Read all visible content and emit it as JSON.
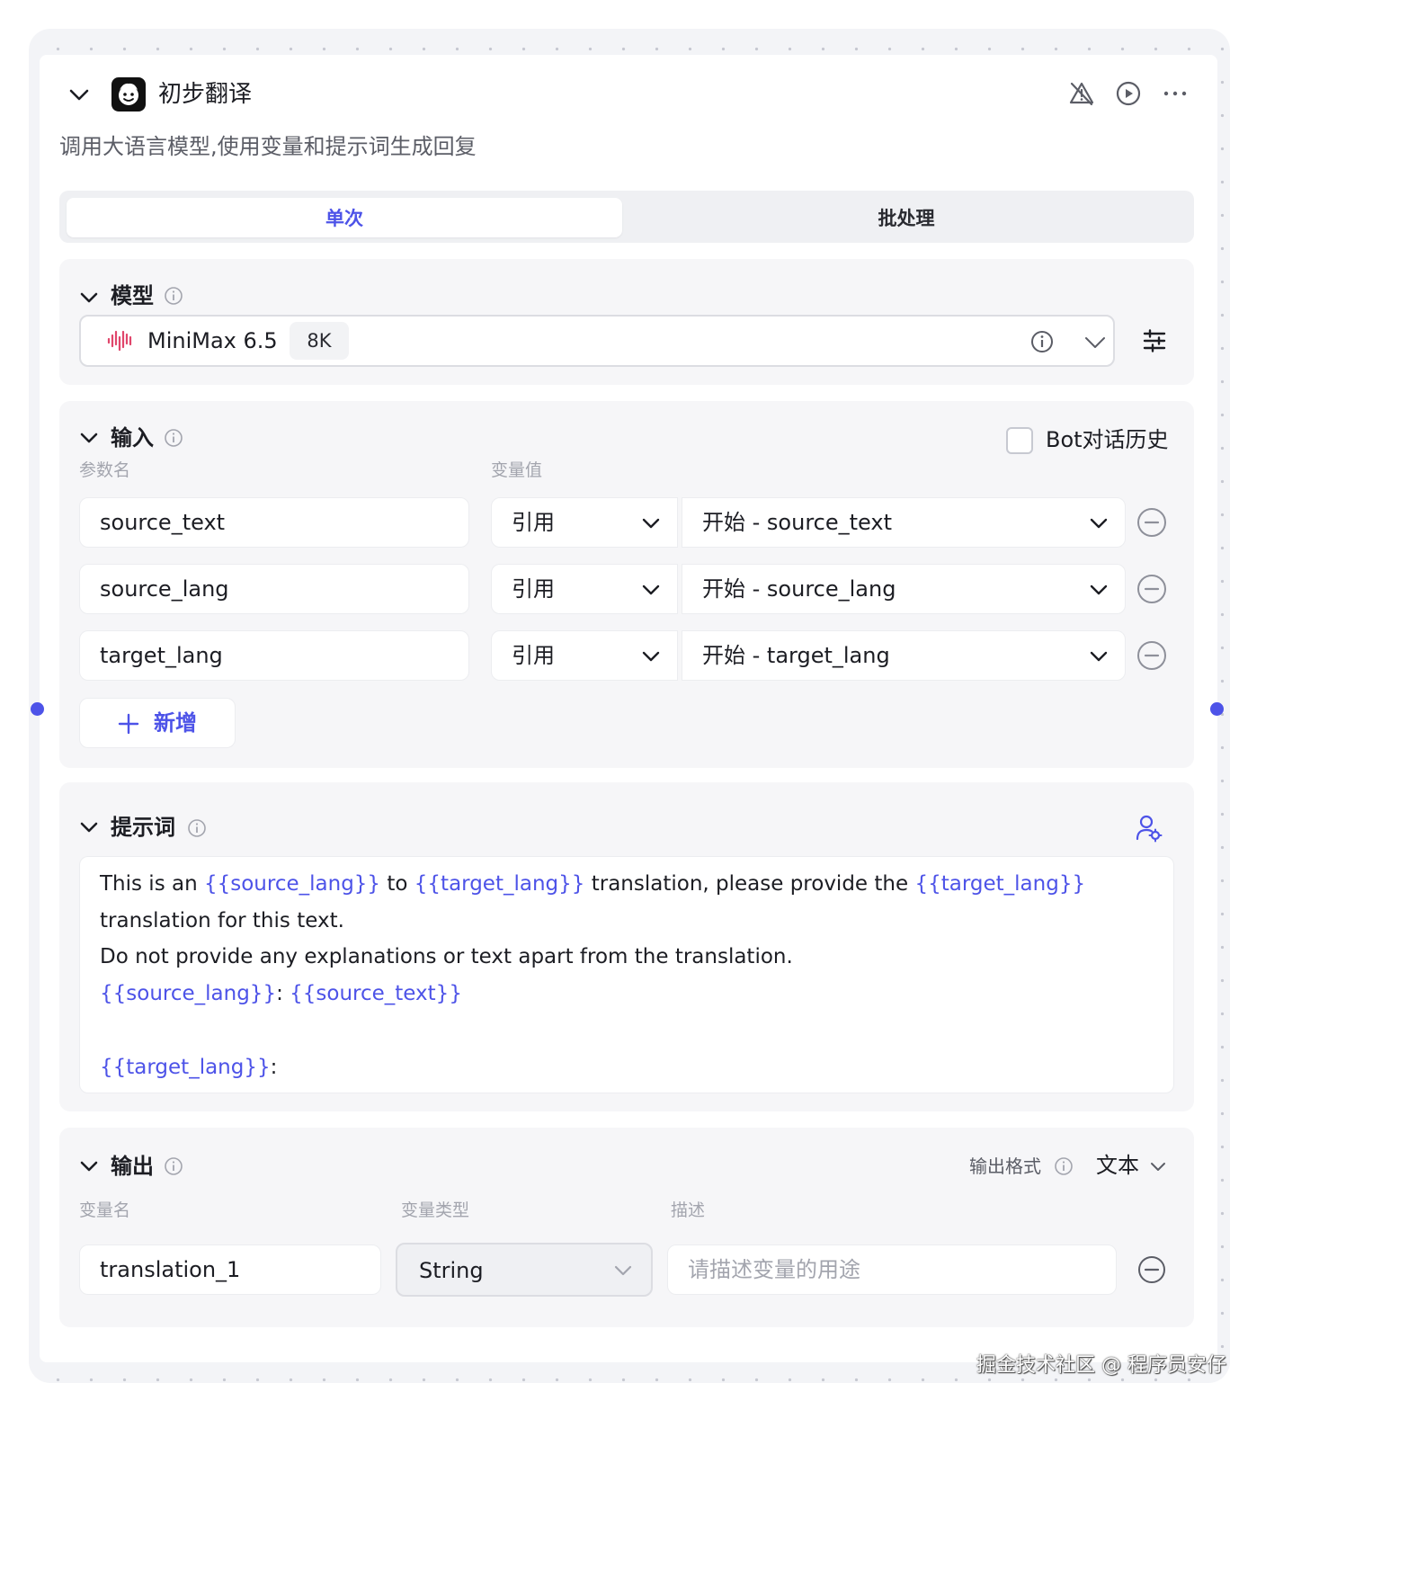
{
  "node": {
    "title": "初步翻译",
    "description": "调用大语言模型,使用变量和提示词生成回复"
  },
  "tabs": [
    {
      "label": "单次",
      "active": true
    },
    {
      "label": "批处理",
      "active": false
    }
  ],
  "model_section": {
    "title": "模型",
    "model_name": "MiniMax 6.5",
    "context_badge": "8K"
  },
  "input_section": {
    "title": "输入",
    "bot_history_label": "Bot对话历史",
    "bot_history_checked": false,
    "col_param": "参数名",
    "col_value": "变量值",
    "rows": [
      {
        "name": "source_text",
        "mode": "引用",
        "source": "开始 - source_text"
      },
      {
        "name": "source_lang",
        "mode": "引用",
        "source": "开始 - source_lang"
      },
      {
        "name": "target_lang",
        "mode": "引用",
        "source": "开始 - target_lang"
      }
    ],
    "add_label": "新增"
  },
  "prompt_section": {
    "title": "提示词",
    "line1_a": "This is an ",
    "line1_var1": "{{source_lang}}",
    "line1_b": " to ",
    "line1_var2": "{{target_lang}}",
    "line1_c": " translation, please provide the ",
    "line1_var3": "{{target_lang}}",
    "line2": "translation for this text.",
    "line3": "Do not provide any explanations or text apart from the translation.",
    "line4_var1": "{{source_lang}}",
    "line4_sep": ": ",
    "line4_var2": "{{source_text}}",
    "line6_var": "{{target_lang}}",
    "line6_suffix": ":"
  },
  "output_section": {
    "title": "输出",
    "format_label": "输出格式",
    "format_value": "文本",
    "col_name": "变量名",
    "col_type": "变量类型",
    "col_desc": "描述",
    "row": {
      "name": "translation_1",
      "type": "String",
      "desc_placeholder": "请描述变量的用途"
    }
  },
  "watermark": "掘金技术社区 @ 程序员安仔",
  "colors": {
    "accent": "#4d53e8",
    "model_logo": "#e0466b"
  }
}
